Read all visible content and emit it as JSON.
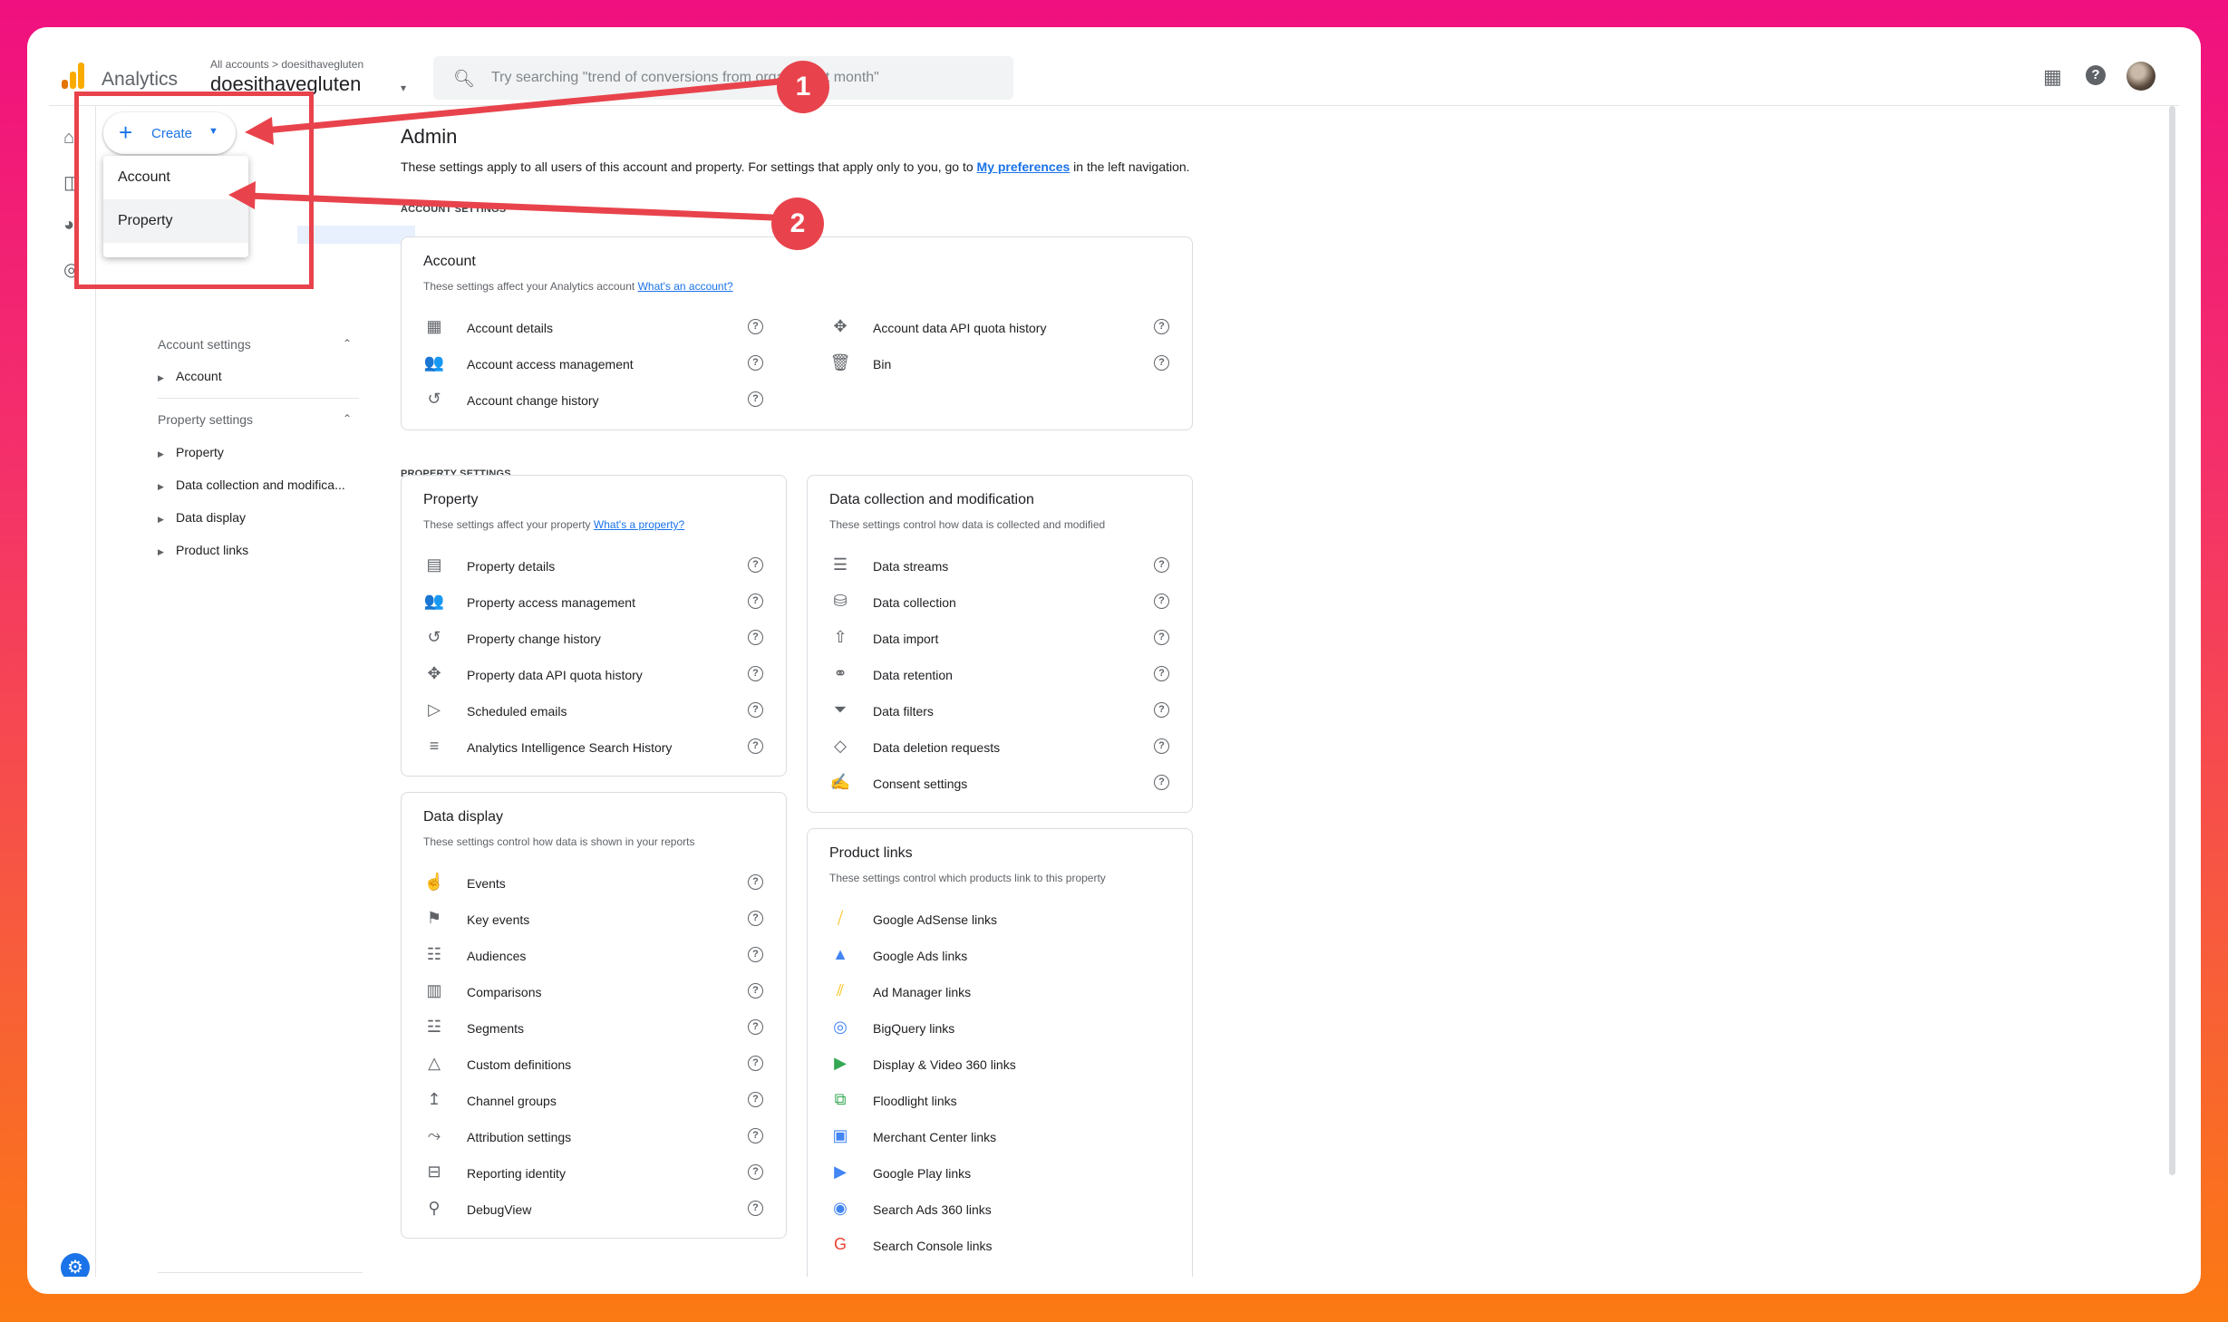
{
  "topbar": {
    "app_name": "Analytics",
    "breadcrumb": "All accounts > doesithavegluten",
    "account_name": "doesithavegluten",
    "search_placeholder": "Try searching \"trend of conversions from organic last month\""
  },
  "create_button": {
    "label": "Create"
  },
  "create_menu": {
    "items": [
      "Account",
      "Property"
    ]
  },
  "sidebar": {
    "account_settings": {
      "header": "Account settings",
      "items": [
        "Account"
      ]
    },
    "property_settings": {
      "header": "Property settings",
      "items": [
        "Property",
        "Data collection and modifica...",
        "Data display",
        "Product links"
      ]
    }
  },
  "main": {
    "title": "Admin",
    "description_pre": "These settings apply to all users of this account and property. For settings that apply only to you, go to",
    "description_link": "My preferences",
    "description_post": "in the left navigation.",
    "account_settings_label": "ACCOUNT SETTINGS",
    "property_settings_label": "PROPERTY SETTINGS"
  },
  "account_card": {
    "title": "Account",
    "desc": "These settings affect your Analytics account",
    "link": "What's an account?",
    "left": [
      {
        "icon": "building-icon",
        "label": "Account details"
      },
      {
        "icon": "people-icon",
        "label": "Account access management"
      },
      {
        "icon": "history-icon",
        "label": "Account change history"
      }
    ],
    "right": [
      {
        "icon": "api-quota-icon",
        "label": "Account data API quota history"
      },
      {
        "icon": "trash-icon",
        "label": "Bin"
      }
    ]
  },
  "property_card": {
    "title": "Property",
    "desc": "These settings affect your property",
    "link": "What's a property?",
    "items": [
      {
        "icon": "property-details-icon",
        "label": "Property details"
      },
      {
        "icon": "people-icon",
        "label": "Property access management"
      },
      {
        "icon": "history-icon",
        "label": "Property change history"
      },
      {
        "icon": "api-quota-icon",
        "label": "Property data API quota history"
      },
      {
        "icon": "scheduled-email-icon",
        "label": "Scheduled emails"
      },
      {
        "icon": "search-history-icon",
        "label": "Analytics Intelligence Search History"
      }
    ]
  },
  "data_collection_card": {
    "title": "Data collection and modification",
    "desc": "These settings control how data is collected and modified",
    "items": [
      {
        "icon": "streams-icon",
        "label": "Data streams"
      },
      {
        "icon": "database-icon",
        "label": "Data collection"
      },
      {
        "icon": "upload-icon",
        "label": "Data import"
      },
      {
        "icon": "retention-icon",
        "label": "Data retention"
      },
      {
        "icon": "filter-icon",
        "label": "Data filters"
      },
      {
        "icon": "eraser-icon",
        "label": "Data deletion requests"
      },
      {
        "icon": "consent-icon",
        "label": "Consent settings"
      }
    ]
  },
  "data_display_card": {
    "title": "Data display",
    "desc": "These settings control how data is shown in your reports",
    "items": [
      {
        "icon": "touch-icon",
        "label": "Events"
      },
      {
        "icon": "flag-icon",
        "label": "Key events"
      },
      {
        "icon": "audience-icon",
        "label": "Audiences"
      },
      {
        "icon": "comparison-icon",
        "label": "Comparisons"
      },
      {
        "icon": "segment-icon",
        "label": "Segments"
      },
      {
        "icon": "shapes-icon",
        "label": "Custom definitions"
      },
      {
        "icon": "merge-icon",
        "label": "Channel groups"
      },
      {
        "icon": "attribution-icon",
        "label": "Attribution settings"
      },
      {
        "icon": "identity-icon",
        "label": "Reporting identity"
      },
      {
        "icon": "debug-icon",
        "label": "DebugView"
      }
    ]
  },
  "product_links_card": {
    "title": "Product links",
    "desc": "These settings control which products link to this property",
    "items": [
      {
        "icon": "adsense-icon",
        "label": "Google AdSense links",
        "color": "#fbbc04"
      },
      {
        "icon": "google-ads-icon",
        "label": "Google Ads links",
        "color": "#4285f4"
      },
      {
        "icon": "ad-manager-icon",
        "label": "Ad Manager links",
        "color": "#fbbc04"
      },
      {
        "icon": "bigquery-icon",
        "label": "BigQuery links",
        "color": "#4285f4"
      },
      {
        "icon": "dv360-icon",
        "label": "Display & Video 360 links",
        "color": "#34a853"
      },
      {
        "icon": "floodlight-icon",
        "label": "Floodlight links",
        "color": "#34a853"
      },
      {
        "icon": "merchant-center-icon",
        "label": "Merchant Center links",
        "color": "#4285f4"
      },
      {
        "icon": "google-play-icon",
        "label": "Google Play links",
        "color": "#4285f4"
      },
      {
        "icon": "sa360-icon",
        "label": "Search Ads 360 links",
        "color": "#4285f4"
      },
      {
        "icon": "search-console-icon",
        "label": "Search Console links",
        "color": "#ea4335"
      }
    ]
  },
  "annotations": {
    "badge1": "1",
    "badge2": "2",
    "color": "#e8434c"
  }
}
